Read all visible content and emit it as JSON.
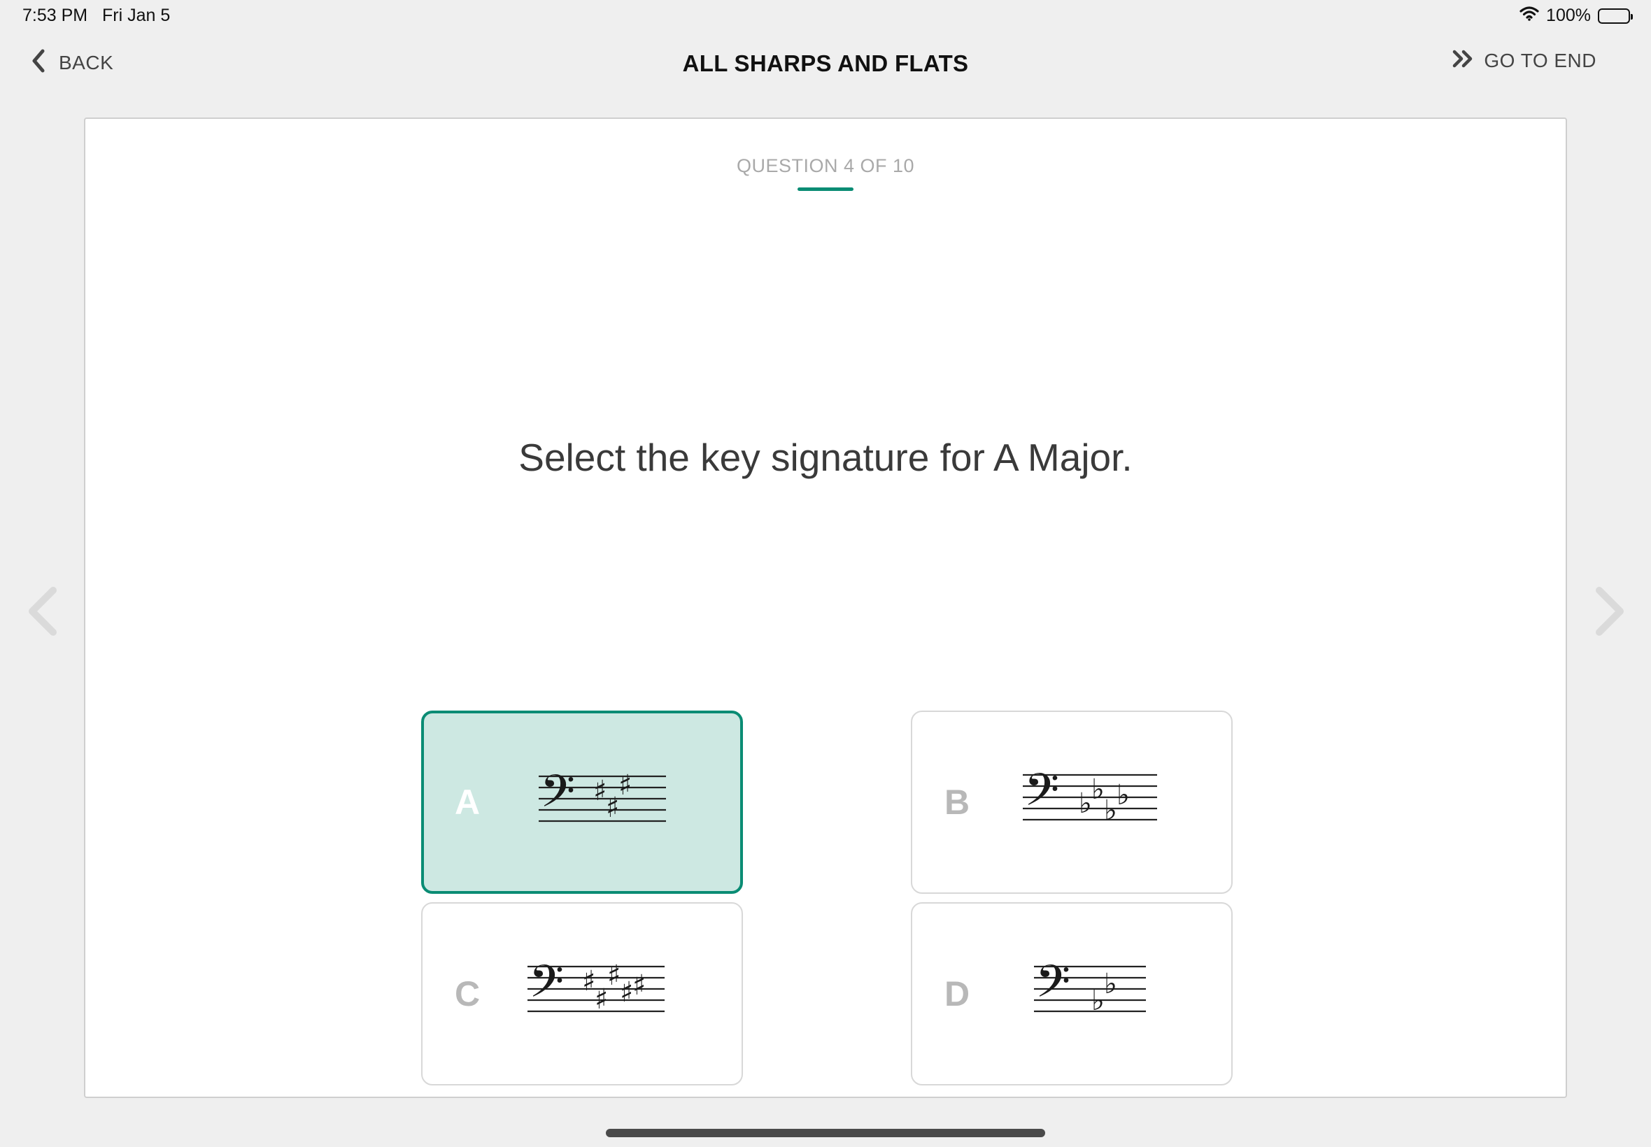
{
  "status_bar": {
    "time": "7:53 PM",
    "date": "Fri Jan 5",
    "battery": "100%"
  },
  "header": {
    "back_label": "BACK",
    "title": "ALL SHARPS AND FLATS",
    "go_to_end_label": "GO TO END"
  },
  "quiz": {
    "counter": "QUESTION 4 OF 10",
    "question": "Select the key signature for A Major.",
    "answers": [
      {
        "letter": "A",
        "key_signature": "3 sharps (bass clef)",
        "selected": true
      },
      {
        "letter": "B",
        "key_signature": "4 flats (bass clef)",
        "selected": false
      },
      {
        "letter": "C",
        "key_signature": "5 sharps (bass clef)",
        "selected": false
      },
      {
        "letter": "D",
        "key_signature": "2 flats (bass clef)",
        "selected": false
      }
    ]
  },
  "colors": {
    "accent": "#0a8c74",
    "selected_bg": "#cde8e2",
    "page_bg": "#efefef"
  },
  "icons": [
    "wifi-icon",
    "battery-icon",
    "chevron-left-icon",
    "double-chevron-right-icon",
    "prev-question-arrow-icon",
    "next-question-arrow-icon"
  ]
}
